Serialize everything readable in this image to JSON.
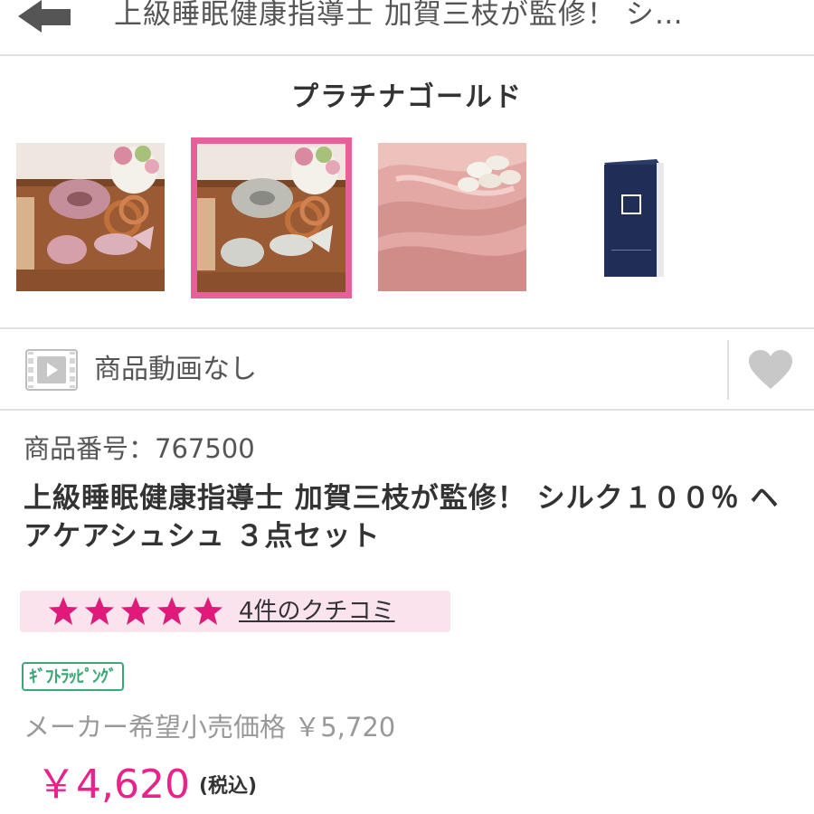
{
  "header": {
    "title": "上級睡眠健康指導士 加賀三枝が監修！ シ…"
  },
  "color_name": "プラチナゴールド",
  "thumbnails": [
    {
      "name": "pink scrunchie set",
      "selected": false
    },
    {
      "name": "platinum gold scrunchie set",
      "selected": true
    },
    {
      "name": "silk fabric with cocoons",
      "selected": false
    },
    {
      "name": "navy gift box",
      "selected": false
    }
  ],
  "video": {
    "label": "商品動画なし"
  },
  "product": {
    "number_text": "商品番号：767500",
    "title": "上級睡眠健康指導士 加賀三枝が監修！ シルク１００％ ヘアケアシュシュ ３点セット"
  },
  "review": {
    "rating": 5,
    "max_rating": 5,
    "link_text": "4件のクチコミ"
  },
  "gift_badge": "ｷﾞﾌﾄﾗｯﾋﾟﾝｸﾞ",
  "price": {
    "list_text": "メーカー希望小売価格 ￥5,720",
    "sale": "￥4,620",
    "tax_label": "(税込)"
  },
  "colors": {
    "accent_pink": "#e8609a",
    "price_pink": "#e8238a",
    "star_pink": "#e0197a",
    "review_bg": "#fbe3ee",
    "gift_green": "#3aa876"
  }
}
